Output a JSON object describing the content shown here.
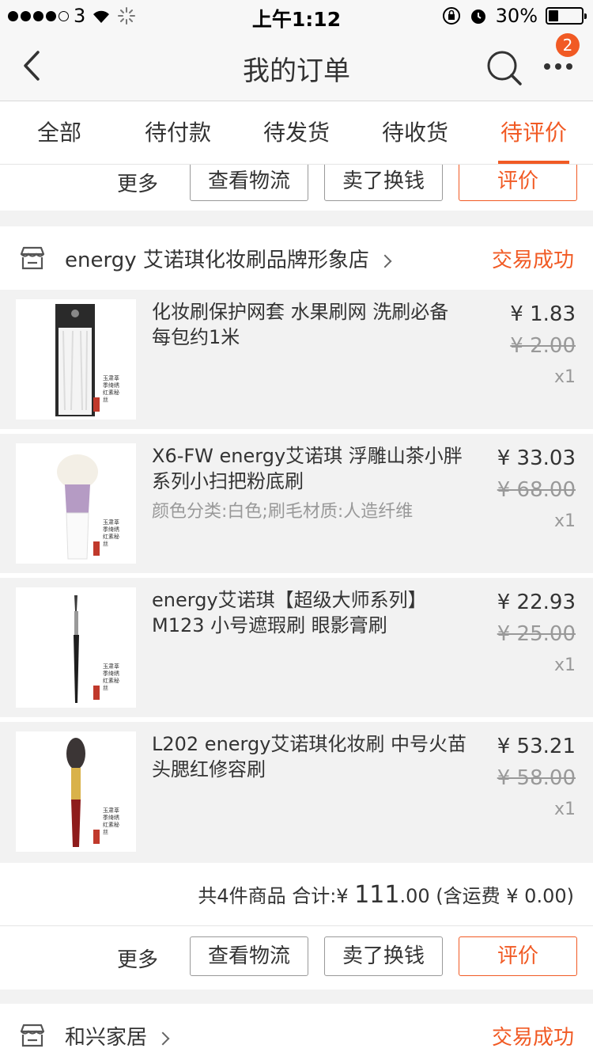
{
  "status_bar": {
    "carrier": "3",
    "time": "上午1:12",
    "battery": "30%",
    "battery_level": 0.3
  },
  "nav": {
    "title": "我的订单",
    "badge": "2",
    "icons": [
      "back-arrow-icon",
      "search-icon",
      "more-dots-icon"
    ]
  },
  "tabs": [
    {
      "label": "全部"
    },
    {
      "label": "待付款"
    },
    {
      "label": "待发货"
    },
    {
      "label": "待收货"
    },
    {
      "label": "待评价",
      "active": true
    }
  ],
  "actions": {
    "more": "更多",
    "logistics": "查看物流",
    "resell": "卖了换钱",
    "review": "评价"
  },
  "order1": {
    "shop_name": "energy 艾诺琪化妆刷品牌形象店",
    "status": "交易成功",
    "items": [
      {
        "title": "化妆刷保护网套 水果刷网 洗刷必备 每包约1米",
        "sku": "",
        "price": "¥ 1.83",
        "original_price": "¥ 2.00",
        "qty": "x1"
      },
      {
        "title": "X6-FW energy艾诺琪 浮雕山茶小胖系列小扫把粉底刷",
        "sku": "颜色分类:白色;刷毛材质:人造纤维",
        "price": "¥ 33.03",
        "original_price": "¥ 68.00",
        "qty": "x1"
      },
      {
        "title": "energy艾诺琪【超级大师系列】M123 小号遮瑕刷 眼影膏刷",
        "sku": "",
        "price": "¥ 22.93",
        "original_price": "¥ 25.00",
        "qty": "x1"
      },
      {
        "title": "L202 energy艾诺琪化妆刷 中号火苗头腮红修容刷",
        "sku": "",
        "price": "¥ 53.21",
        "original_price": "¥ 58.00",
        "qty": "x1"
      }
    ],
    "summary": {
      "count_label": "共4件商品 合计:",
      "currency": "¥",
      "total_int": "111",
      "total_dec": ".00",
      "shipping": "(含运费 ¥ 0.00)"
    }
  },
  "order2": {
    "shop_name": "和兴家居",
    "status": "交易成功"
  },
  "stamp_text": "玉肃莘季绮绣红素秘丝",
  "colors": {
    "accent": "#f15a24",
    "muted": "#999999",
    "bg": "#f2f2f2"
  }
}
